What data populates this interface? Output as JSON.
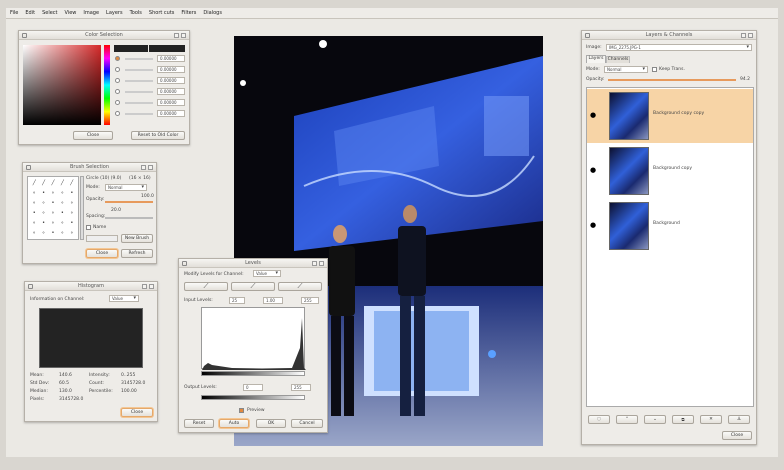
{
  "menu": [
    "File",
    "Edit",
    "Select",
    "View",
    "Image",
    "Layers",
    "Tools",
    "Short cuts",
    "Filters",
    "Dialogs"
  ],
  "color_selection": {
    "title": "Color Selection",
    "channel_values": [
      "0.00000",
      "0.00000",
      "0.00000",
      "0.00000",
      "0.00000",
      "0.00000"
    ],
    "close": "Close",
    "reset": "Reset to Old Color"
  },
  "brush_selection": {
    "title": "Brush Selection",
    "brush_name": "Circle (10) (9.0)",
    "brush_size": "(16 × 16)",
    "mode_label": "Mode:",
    "mode_value": "Normal",
    "opacity_label": "Opacity:",
    "opacity_value": "100.0",
    "spacing_label": "Spacing:",
    "spacing_value": "20.0",
    "name_label": "Name",
    "new_brush": "New Brush",
    "close": "Close",
    "refresh": "Refresh"
  },
  "histogram": {
    "title": "Histogram",
    "channel_label": "Information on Channel:",
    "channel_value": "Value",
    "stats": [
      [
        "Mean:",
        "140.6",
        "Intensity:",
        "0..255"
      ],
      [
        "Std Dev:",
        "60.5",
        "Count:",
        "3145728.0"
      ],
      [
        "Median:",
        "130.0",
        "Percentile:",
        "100.00"
      ],
      [
        "Pixels:",
        "3145728.0",
        "",
        ""
      ]
    ],
    "close": "Close"
  },
  "levels": {
    "title": "Levels",
    "channel_label": "Modify Levels for Channel:",
    "channel_value": "Value",
    "input_label": "Input Levels:",
    "input_values": [
      "25",
      "1.00",
      "255"
    ],
    "output_label": "Output Levels:",
    "output_values": [
      "0",
      "255"
    ],
    "preview_label": "Preview",
    "reset": "Reset",
    "auto": "Auto",
    "ok": "OK",
    "cancel": "Cancel"
  },
  "layers": {
    "title": "Layers & Channels",
    "image_label": "Image:",
    "image_value": "IMG_2275.JPG-1",
    "tabs": [
      "Layers",
      "Channels"
    ],
    "mode_label": "Mode:",
    "mode_value": "Normal",
    "keep_trans": "Keep Trans.",
    "opacity_label": "Opacity:",
    "opacity_value": "94.2",
    "items": [
      "Background copy copy",
      "Background copy",
      "Background"
    ],
    "close": "Close"
  },
  "colors": {
    "accent": "#f7d4a6",
    "titlebar": "#e2dfd9",
    "panel": "#eeece8"
  }
}
